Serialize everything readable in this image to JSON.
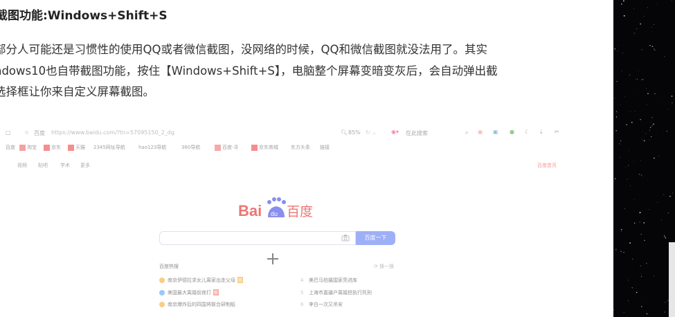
{
  "article": {
    "heading": "截图功能:Windows+Shift+S",
    "lines": [
      "部分人可能还是习惯性的使用QQ或者微信截图，没网络的时候，QQ和微信截图就没法用了。其实",
      "ndows10也自带截图功能，按住【Windows+Shift+S】，电脑整个屏幕变暗变灰后，会自动弹出截",
      "选择框让你来自定义屏幕截图。"
    ]
  },
  "browser": {
    "site_label": "百度",
    "url": "https://www.baidu.com/?tn=57095150_2_dg",
    "zoom": "85%",
    "search_engine_hint": "在此搜索",
    "bookmarks": [
      "百度",
      "淘宝",
      "京东",
      "天猫",
      "2345网址导航",
      "hao123导航",
      "360导航",
      "百度·寻",
      "京东商城",
      "东方头条",
      "链接"
    ],
    "nav_links": [
      "视频",
      "贴吧",
      "学术",
      "更多"
    ],
    "account_link": "百度首页"
  },
  "baidu": {
    "logo_bai": "Bai",
    "logo_du": "du",
    "logo_cn": "百度",
    "search_button": "百度一下",
    "hot_title": "百度热搜",
    "refresh": "换一换",
    "hot_left": [
      {
        "text": "南京伊德拉求女儿离家出走父母",
        "color": "#f5a623",
        "tag": "热",
        "tag_color": "#f5a623"
      },
      {
        "text": "美国最大离婚前夜打",
        "color": "#4e9bf2",
        "tag": "新",
        "tag_color": "#f26a5b"
      },
      {
        "text": "南京爆炸后的四国将联合研制船",
        "color": "#f5a623",
        "tag": "",
        "tag_color": ""
      }
    ],
    "hot_right": [
      {
        "num": "4",
        "text": "美巴马拍摄国家亮进库"
      },
      {
        "num": "5",
        "text": "上海市嘉疆户离婚担执行死刑"
      },
      {
        "num": "6",
        "text": "李白一次又吊安"
      }
    ]
  },
  "colors": {
    "baidu_red": "#e10602",
    "baidu_blue": "#2932e1",
    "search_blue": "#4e6ef2",
    "space_bg": "#050508"
  }
}
